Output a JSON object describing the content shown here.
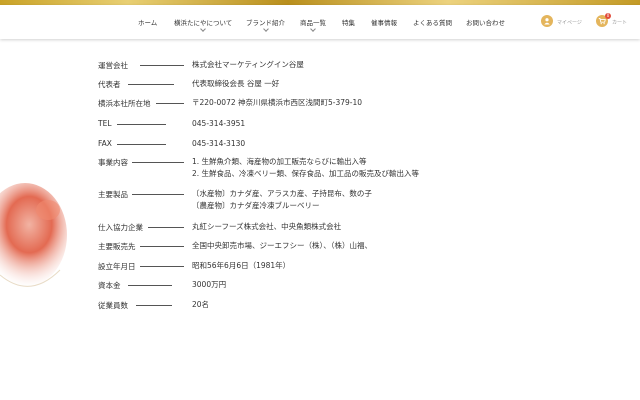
{
  "nav": {
    "items": [
      {
        "label": "ホーム",
        "has_dropdown": false
      },
      {
        "label": "横浜たにやについて",
        "has_dropdown": true
      },
      {
        "label": "ブランド紹介",
        "has_dropdown": true
      },
      {
        "label": "商品一覧",
        "has_dropdown": true
      },
      {
        "label": "特集",
        "has_dropdown": false
      },
      {
        "label": "催事情報",
        "has_dropdown": false
      },
      {
        "label": "よくある質問",
        "has_dropdown": false
      },
      {
        "label": "お問い合わせ",
        "has_dropdown": false
      }
    ],
    "mypage_label": "マイページ",
    "cart_label": "カート",
    "cart_count": "0"
  },
  "company": {
    "rows": [
      {
        "label": "運営会社",
        "values": [
          "株式会社マーケティングイン谷屋"
        ]
      },
      {
        "label": "代表者",
        "values": [
          "代表取締役会長 谷屋 一好"
        ]
      },
      {
        "label": "横浜本社所在地",
        "values": [
          "〒220-0072 神奈川県横浜市西区浅間町5-379-10"
        ]
      },
      {
        "label": "TEL",
        "values": [
          "045-314-3951"
        ]
      },
      {
        "label": "FAX",
        "values": [
          "045-314-3130"
        ]
      },
      {
        "label": "事業内容",
        "values": [
          "1. 生鮮魚介類、海産物の加工販売ならびに輸出入等",
          "2. 生鮮食品、冷凍ベリー類、保存食品、加工品の販売及び輸出入等"
        ]
      },
      {
        "label": "主要製品",
        "values": [
          "〔水産物〕カナダ産、アラスカ産、子持昆布、数の子",
          "〔農産物〕カナダ産冷凍ブルーベリー"
        ]
      },
      {
        "label": "仕入協力企業",
        "values": [
          "丸紅シーフーズ株式会社、中央魚類株式会社"
        ]
      },
      {
        "label": "主要販売先",
        "values": [
          "全国中央卸売市場、ジーエフシー（株）、（株）山福、"
        ]
      },
      {
        "label": "設立年月日",
        "values": [
          "昭和56年6月6日（1981年）"
        ]
      },
      {
        "label": "資本金",
        "values": [
          "3000万円"
        ]
      },
      {
        "label": "従業員数",
        "values": [
          "20名"
        ]
      }
    ]
  },
  "colors": {
    "gold": "#c9a227",
    "accent_icon": "#e4b55c",
    "badge": "#e14b3b"
  }
}
